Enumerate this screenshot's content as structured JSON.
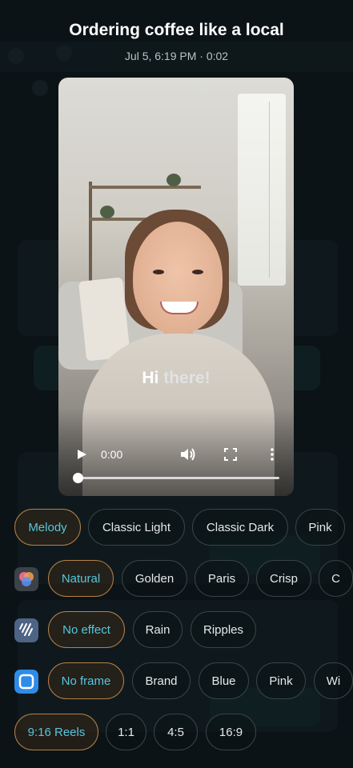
{
  "header": {
    "title": "Ordering coffee like a local",
    "subtitle": "Jul 5, 6:19 PM · 0:02"
  },
  "video": {
    "caption_word1": "Hi",
    "caption_word2": "there!",
    "current_time": "0:00",
    "progress": 0
  },
  "rows": {
    "themes": [
      "Melody",
      "Classic Light",
      "Classic Dark",
      "Pink"
    ],
    "filters": [
      "Natural",
      "Golden",
      "Paris",
      "Crisp",
      "C"
    ],
    "effects": [
      "No effect",
      "Rain",
      "Ripples"
    ],
    "frames": [
      "No frame",
      "Brand",
      "Blue",
      "Pink",
      "Wi"
    ],
    "ratios": [
      "9:16 Reels",
      "1:1",
      "4:5",
      "16:9"
    ]
  },
  "colors": {
    "selected_border": "#b48147",
    "selected_text": "#55c7dc",
    "background": "#0b1316"
  }
}
